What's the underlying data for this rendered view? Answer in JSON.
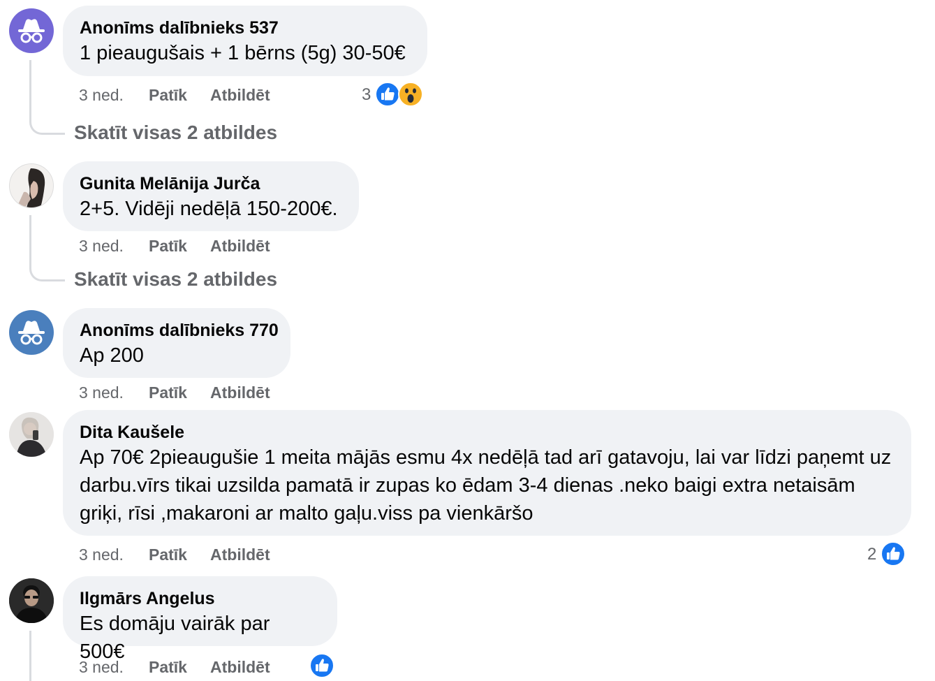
{
  "comments": [
    {
      "author": "Anonīms dalībnieks 537",
      "text": "1 pieaugušais + 1 bērns (5g) 30-50€",
      "time": "3 ned.",
      "like": "Patīk",
      "reply": "Atbildēt",
      "reactions_count": "3",
      "reactions": [
        "like-icon",
        "wow-icon"
      ],
      "view_replies": "Skatīt visas 2 atbildes",
      "avatar": "anonymous-icon",
      "avatar_color": "#7367d6"
    },
    {
      "author": "Gunita Melānija Jurča",
      "text": "2+5. Vidēji nedēļā 150-200€.",
      "time": "3 ned.",
      "like": "Patīk",
      "reply": "Atbildēt",
      "view_replies": "Skatīt visas 2 atbildes",
      "avatar": "profile-photo"
    },
    {
      "author": "Anonīms dalībnieks 770",
      "text": "Ap 200",
      "time": "3 ned.",
      "like": "Patīk",
      "reply": "Atbildēt",
      "avatar": "anonymous-icon",
      "avatar_color": "#4a7fbd"
    },
    {
      "author": "Dita Kaušele",
      "text": "Ap 70€ 2pieaugušie 1 meita mājās esmu 4x nedēļā tad arī gatavoju, lai var līdzi paņemt uz darbu.vīrs tikai uzsilda pamatā ir zupas ko ēdam 3-4 dienas .neko baigi extra netaisām griķi, rīsi ,makaroni ar malto gaļu.viss pa vienkāršo",
      "time": "3 ned.",
      "like": "Patīk",
      "reply": "Atbildēt",
      "reactions_count": "2",
      "reactions": [
        "like-icon"
      ],
      "avatar": "profile-photo"
    },
    {
      "author": "Ilgmārs Angelus",
      "text": "Es domāju vairāk par 500€",
      "time": "3 ned.",
      "like": "Patīk",
      "reply": "Atbildēt",
      "reactions": [
        "like-icon"
      ],
      "avatar": "profile-photo"
    }
  ],
  "colors": {
    "bubble": "#f0f2f5",
    "secondary_text": "#65676b",
    "like_blue": "#1877f2",
    "thread_line": "#d9dbdf"
  }
}
